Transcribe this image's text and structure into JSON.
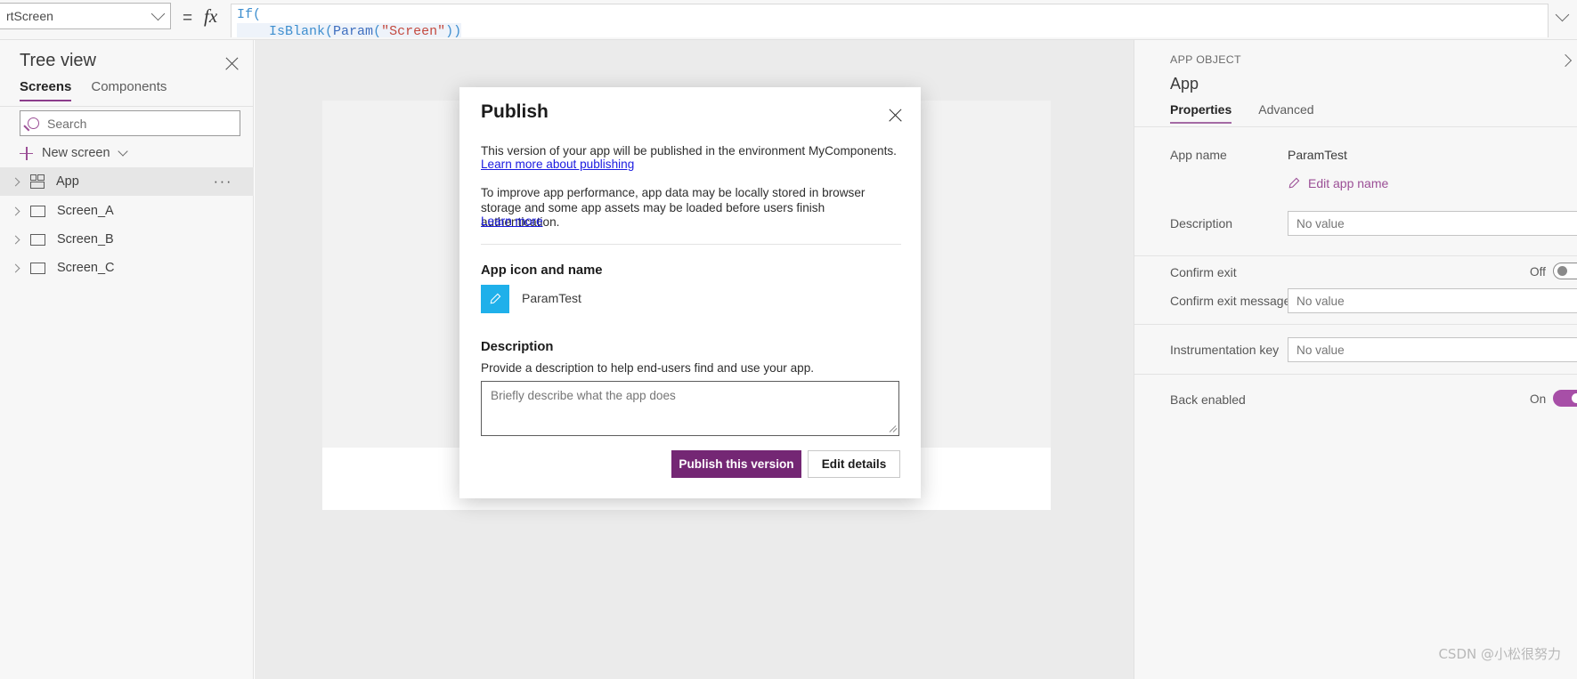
{
  "topbar": {
    "property_selected": "rtScreen",
    "equals_sign": "=",
    "fx_label": "fx",
    "formula_line1": "If(",
    "formula_line2_dots": "    ",
    "formula_line2_fn": "IsBlank",
    "formula_line2_open": "(",
    "formula_line2_fn2": "Param",
    "formula_line2_open2": "(",
    "formula_line2_str": "\"Screen\"",
    "formula_line2_close": "))"
  },
  "treeview": {
    "title": "Tree view",
    "tabs": [
      {
        "label": "Screens",
        "active": true
      },
      {
        "label": "Components",
        "active": false
      }
    ],
    "search_placeholder": "Search",
    "new_screen_label": "New screen",
    "items": [
      {
        "label": "App",
        "icon": "app-grid-icon",
        "selected": true,
        "has_overflow": true,
        "overflow": "···"
      },
      {
        "label": "Screen_A",
        "icon": "screen-icon",
        "selected": false,
        "has_overflow": false
      },
      {
        "label": "Screen_B",
        "icon": "screen-icon",
        "selected": false,
        "has_overflow": false
      },
      {
        "label": "Screen_C",
        "icon": "screen-icon",
        "selected": false,
        "has_overflow": false
      }
    ]
  },
  "modal": {
    "title": "Publish",
    "paragraph1": "This version of your app will be published in the environment MyComponents.",
    "link1": "Learn more about publishing",
    "paragraph2": "To improve app performance, app data may be locally stored in browser storage and some app assets may be loaded before users finish authentication.",
    "link2": "Learn more",
    "section_app_icon_title": "App icon and name",
    "app_name": "ParamTest",
    "section_description_title": "Description",
    "description_subtitle": "Provide a description to help end-users find and use your app.",
    "description_placeholder": "Briefly describe what the app does",
    "description_value": "",
    "primary_button": "Publish this version",
    "secondary_button": "Edit details"
  },
  "rightpanel": {
    "object_label": "APP OBJECT",
    "help_glyph": "?",
    "object_name": "App",
    "tabs": [
      {
        "label": "Properties",
        "active": true
      },
      {
        "label": "Advanced",
        "active": false
      }
    ],
    "rows": [
      {
        "key": "App name",
        "type": "text",
        "value": "ParamTest"
      },
      {
        "key": "",
        "type": "editlink",
        "value": "Edit app name"
      },
      {
        "key": "Description",
        "type": "input",
        "value": "No value"
      },
      {
        "key": "Confirm exit",
        "type": "toggle",
        "state": "Off",
        "on": false
      },
      {
        "key": "Confirm exit message",
        "type": "input",
        "value": "No value"
      },
      {
        "key": "Instrumentation key",
        "type": "input",
        "value": "No value"
      },
      {
        "key": "Back enabled",
        "type": "toggle",
        "state": "On",
        "on": true
      }
    ]
  },
  "watermark": {
    "text": "CSDN @小松很努力"
  },
  "colors": {
    "accent_purple": "#9b4f96",
    "primary_button": "#742774",
    "tab_underline": "#8c3d8c",
    "app_icon_blue": "#1fb0ea",
    "link_blue": "#1a1ae0",
    "toggle_on": "#a74fa7"
  }
}
